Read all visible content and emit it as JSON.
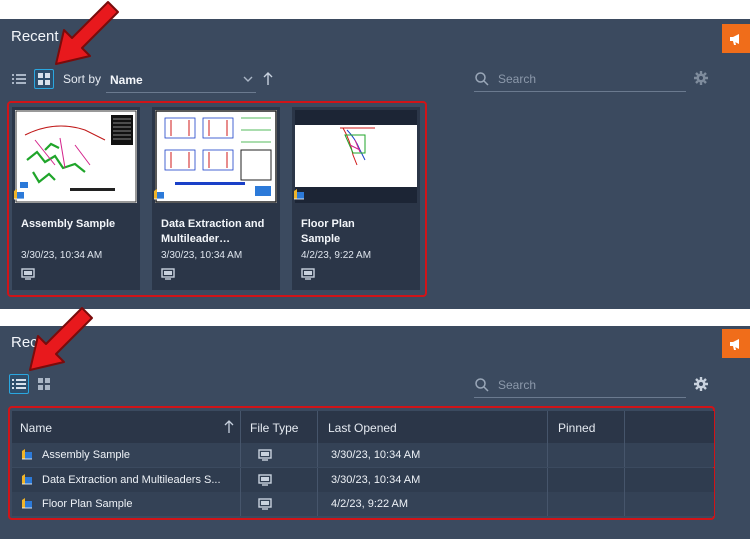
{
  "panel1": {
    "title": "Recent",
    "sort_label": "Sort by",
    "sort_value": "Name",
    "search_placeholder": "Search",
    "cards": [
      {
        "name": "Assembly Sample",
        "date": "3/30/23, 10:34 AM"
      },
      {
        "name": "Data Extraction and Multileader…",
        "date": "3/30/23, 10:34 AM"
      },
      {
        "name": "Floor Plan Sample",
        "date": "4/2/23, 9:22 AM"
      }
    ]
  },
  "panel2": {
    "title": "Rec",
    "search_placeholder": "Search",
    "columns": [
      "Name",
      "File Type",
      "Last Opened",
      "Pinned"
    ],
    "rows": [
      {
        "name": "Assembly Sample",
        "last_opened": "3/30/23, 10:34 AM"
      },
      {
        "name": "Data Extraction and Multileaders S...",
        "last_opened": "3/30/23, 10:34 AM"
      },
      {
        "name": "Floor Plan Sample",
        "last_opened": "4/2/23, 9:22 AM"
      }
    ]
  },
  "icons": {
    "list_view": "list-view-icon",
    "grid_view": "grid-view-icon",
    "search": "search-icon",
    "settings": "gear-icon",
    "feedback": "megaphone-icon",
    "file_type": "monitor-icon",
    "dwg": "dwg-file-icon",
    "sort_direction": "arrow-up-icon",
    "annotation": "red-arrow"
  },
  "colors": {
    "panel_bg": "#3b4a5f",
    "card_bg": "#2b3648",
    "accent": "#2aa7e0",
    "feedback": "#f06d1a",
    "highlight": "#d01418"
  }
}
